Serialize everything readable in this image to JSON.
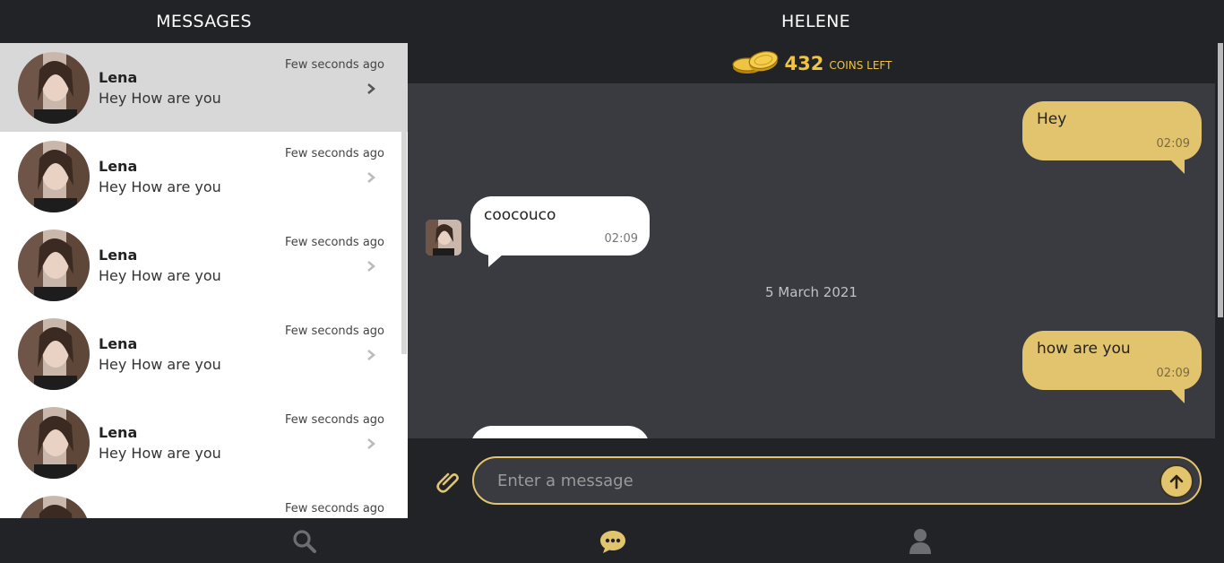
{
  "left_header": {
    "title": "MESSAGES"
  },
  "right_header": {
    "title": "HELENE"
  },
  "coins": {
    "count": "432",
    "label": "COINS LEFT",
    "icon": "coins-icon",
    "color": "#f0c443"
  },
  "conversations": [
    {
      "name": "Lena",
      "preview": "Hey How are you",
      "time": "Few seconds ago",
      "active": true
    },
    {
      "name": "Lena",
      "preview": "Hey How are you",
      "time": "Few seconds ago",
      "active": false
    },
    {
      "name": "Lena",
      "preview": "Hey How are you",
      "time": "Few seconds ago",
      "active": false
    },
    {
      "name": "Lena",
      "preview": "Hey How are you",
      "time": "Few seconds ago",
      "active": false
    },
    {
      "name": "Lena",
      "preview": "Hey How are you",
      "time": "Few seconds ago",
      "active": false
    },
    {
      "name": "",
      "preview": "",
      "time": "Few seconds ago",
      "active": false
    }
  ],
  "messages": [
    {
      "direction": "outgoing",
      "text": "Hey",
      "time": "02:09"
    },
    {
      "direction": "incoming",
      "text": "coocouco",
      "time": "02:09"
    },
    {
      "type": "date",
      "text": "5 March 2021"
    },
    {
      "direction": "outgoing",
      "text": "how are you",
      "time": "02:09"
    },
    {
      "direction": "incoming",
      "text": "",
      "time": ""
    }
  ],
  "composer": {
    "placeholder": "Enter a message",
    "value": ""
  },
  "nav": [
    {
      "icon": "search-icon",
      "active": false
    },
    {
      "icon": "chat-icon",
      "active": true
    },
    {
      "icon": "user-icon",
      "active": false
    }
  ],
  "colors": {
    "accent": "#e3c46e",
    "background": "#212326",
    "chat_bg": "#393b40"
  }
}
